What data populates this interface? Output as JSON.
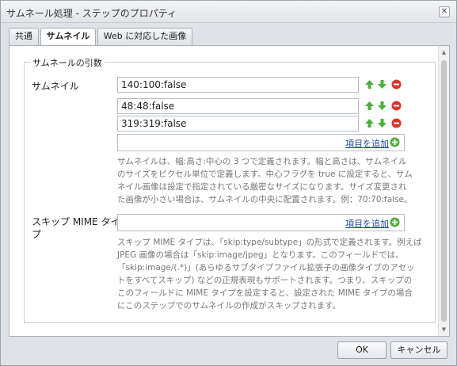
{
  "dialog": {
    "title": "サムネール処理 - ステップのプロパティ",
    "close_symbol": "✕"
  },
  "tabs": [
    {
      "label": "共通",
      "active": false
    },
    {
      "label": "サムネイル",
      "active": true
    },
    {
      "label": "Web に対応した画像",
      "active": false
    }
  ],
  "fieldset": {
    "legend": "サムネールの引数"
  },
  "thumbnails": {
    "label": "サムネイル",
    "values": [
      "140:100:false",
      "48:48:false",
      "319:319:false"
    ],
    "add_label": "項目を追加",
    "help": [
      "サムネイルは、幅:高さ:中心の 3 つで定義されます。幅と高さは、サムネイル",
      "のサイズをピクセル単位で定義します。中心フラグを true に設定すると、サム",
      "ネイル画像は設定で指定されている厳密なサイズになります。サイズ変更され",
      "た画像が小さい場合は、サムネイルの中央に配置されます。例：70:70:false。"
    ]
  },
  "skip_mime": {
    "label_line1": "スキップ MIME タイ",
    "label_line2": "プ",
    "add_label": "項目を追加",
    "help": [
      "スキップ MIME タイプは、「skip:type/subtype」の形式で定義されます。例えば",
      "JPEG 画像の場合は「skip:image/jpeg」となります。このフィールドでは、",
      "「skip:image/(.*)」(あらゆるサブタイプファイル拡張子の画像タイプのアセッ",
      "トをすべてスキップ) などの正規表現もサポートされます。つまり、スキップの",
      "このフィールドに MIME タイプを設定すると、設定された MIME タイプの場合",
      "にこのステップでのサムネイルの作成がスキップされます。"
    ]
  },
  "footer": {
    "ok_label": "OK",
    "cancel_label": "キャンセル"
  },
  "colors": {
    "up": "#4caf3a",
    "down": "#4caf3a",
    "remove": "#d9352b",
    "add": "#4caf3a"
  }
}
